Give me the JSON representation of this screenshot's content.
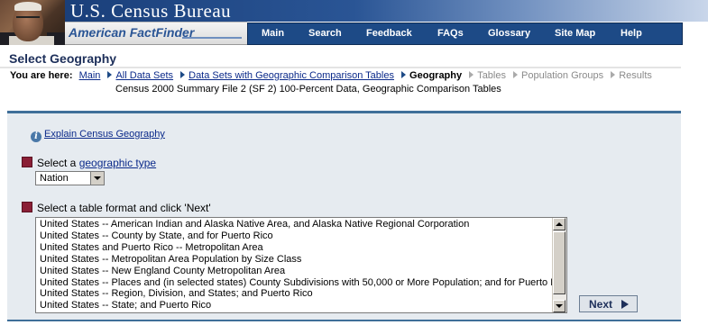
{
  "header": {
    "bureau_title": "U.S. Census Bureau",
    "product_name": "American FactFinder",
    "nav": [
      "Main",
      "Search",
      "Feedback",
      "FAQs",
      "Glossary",
      "Site Map",
      "Help"
    ]
  },
  "page": {
    "title": "Select Geography"
  },
  "breadcrumb": {
    "label": "You are here:",
    "links": [
      "Main",
      "All Data Sets",
      "Data Sets with Geographic Comparison Tables"
    ],
    "current": "Geography",
    "upcoming": [
      "Tables",
      "Population Groups",
      "Results"
    ],
    "dataset": "Census 2000 Summary File 2 (SF 2) 100-Percent Data, Geographic Comparison Tables"
  },
  "content": {
    "explain_link": "Explain Census Geography",
    "step1_prefix": "Select a ",
    "step1_link": "geographic type",
    "geo_type_selected": "Nation",
    "step2_text": "Select a table format and click 'Next'",
    "table_formats": [
      "United States -- American Indian and Alaska Native Area, and Alaska Native Regional Corporation",
      "United States -- County by State, and for Puerto Rico",
      "United States and Puerto Rico -- Metropolitan Area",
      "United States -- Metropolitan Area Population by Size Class",
      "United States -- New England County Metropolitan Area",
      "United States -- Places and (in selected states) County Subdivisions with 50,000 or More Population; and for Puerto Rico",
      "United States -- Region, Division, and States; and Puerto Rico",
      "United States -- State; and Puerto Rico"
    ],
    "next_label": "Next"
  },
  "colors": {
    "nav_bar": "#1d4a86",
    "bullet": "#8a1f36",
    "panel": "#e6ebf0",
    "rule": "#3f6f99",
    "link": "#0b2a8a"
  },
  "icons": {
    "info": "info-icon",
    "next_arrow": "arrow-right-icon",
    "breadcrumb_arrow": "chevron-right-icon"
  }
}
